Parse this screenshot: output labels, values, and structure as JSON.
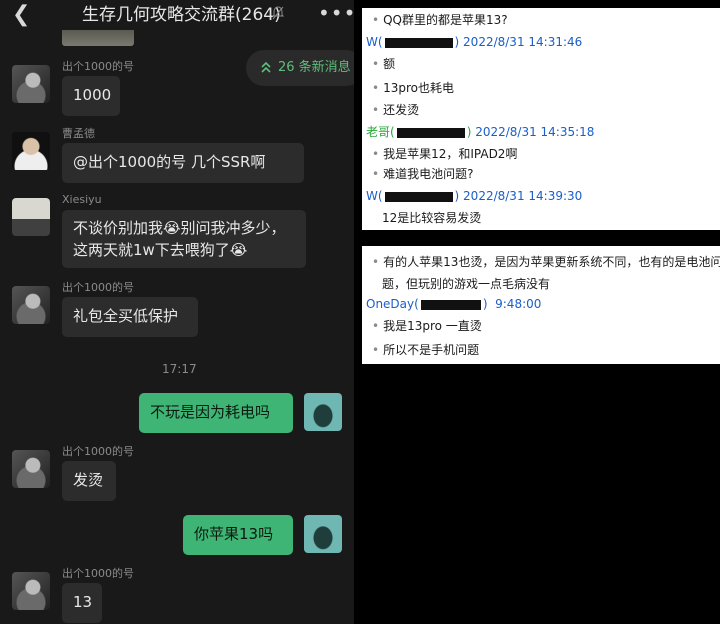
{
  "chat": {
    "title": "生存几何攻略交流群(264)",
    "new_messages": "26 条新消息",
    "timestamp": "17:17",
    "messages": [
      {
        "sender": "出个1000的号",
        "text": "1000"
      },
      {
        "sender": "曹孟德",
        "text": "@出个1000的号   几个SSR啊"
      },
      {
        "sender": "Xiesiyu",
        "text": "不谈价别加我😭别问我冲多少，这两天就1w下去喂狗了😭"
      },
      {
        "sender": "出个1000的号",
        "text": "礼包全买低保护"
      },
      {
        "sender": "me",
        "text": "不玩是因为耗电吗"
      },
      {
        "sender": "出个1000的号",
        "text": "发烫"
      },
      {
        "sender": "me",
        "text": "你苹果13吗"
      },
      {
        "sender": "出个1000的号",
        "text": "13"
      }
    ]
  },
  "qq1": {
    "lines": [
      {
        "type": "msg",
        "text": "QQ群里的都是苹果13?"
      },
      {
        "type": "hdr",
        "name": "W(",
        "time": "2022/8/31 14:31:46"
      },
      {
        "type": "msg",
        "text": "额"
      },
      {
        "type": "msg",
        "text": "13pro也耗电"
      },
      {
        "type": "msg",
        "text": "还发烫"
      },
      {
        "type": "hdr",
        "name": "老哥(",
        "time": "2022/8/31 14:35:18"
      },
      {
        "type": "msg",
        "text": "我是苹果12，和IPAD2啊"
      },
      {
        "type": "msg",
        "text": "难道我电池问题?"
      },
      {
        "type": "hdr",
        "name": "W(",
        "time": "2022/8/31 14:39:30"
      },
      {
        "type": "msg",
        "text": "12是比较容易发烫"
      }
    ]
  },
  "qq2": {
    "lines": [
      {
        "type": "msg",
        "text": "有的人苹果13也烫，是因为苹果更新系统不同，也有的是电池问"
      },
      {
        "type": "cont",
        "text": "题，但玩别的游戏一点毛病没有"
      },
      {
        "type": "hdr",
        "name": "OneDay(",
        "time": "9:48:00"
      },
      {
        "type": "msg",
        "text": "我是13pro  一直烫"
      },
      {
        "type": "msg",
        "text": "所以不是手机问题"
      }
    ]
  }
}
